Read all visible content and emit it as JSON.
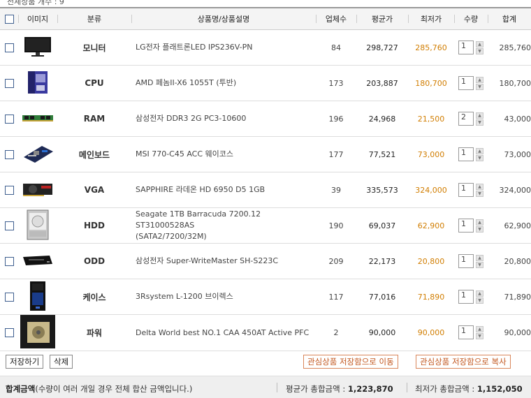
{
  "top_caption": "전체상품 개수 : 9",
  "header": {
    "image": "이미지",
    "category": "분류",
    "name": "상품명/상품설명",
    "sellers": "업체수",
    "avg_price": "평균가",
    "min_price": "최저가",
    "qty": "수량",
    "total": "합계"
  },
  "rows": [
    {
      "category": "모니터",
      "name": "LG전자 플래트론LED IPS236V-PN",
      "sellers": "84",
      "avg": "298,727",
      "min": "285,760",
      "qty": "1",
      "total": "285,760",
      "icon": "monitor-thumbnail"
    },
    {
      "category": "CPU",
      "name": "AMD 페놈II-X6 1055T (투반)",
      "sellers": "173",
      "avg": "203,887",
      "min": "180,700",
      "qty": "1",
      "total": "180,700",
      "icon": "cpu-box-thumbnail"
    },
    {
      "category": "RAM",
      "name": "삼성전자 DDR3 2G PC3-10600",
      "sellers": "196",
      "avg": "24,968",
      "min": "21,500",
      "qty": "2",
      "total": "43,000",
      "icon": "ram-stick-thumbnail"
    },
    {
      "category": "메인보드",
      "name": "MSI 770-C45 ACC 웨이코스",
      "sellers": "177",
      "avg": "77,521",
      "min": "73,000",
      "qty": "1",
      "total": "73,000",
      "icon": "motherboard-thumbnail"
    },
    {
      "category": "VGA",
      "name": "SAPPHIRE 라데온 HD 6950 D5 1GB",
      "sellers": "39",
      "avg": "335,573",
      "min": "324,000",
      "qty": "1",
      "total": "324,000",
      "icon": "graphics-card-thumbnail"
    },
    {
      "category": "HDD",
      "name": "Seagate 1TB Barracuda 7200.12 ST31000528AS",
      "name2": "(SATA2/7200/32M)",
      "sellers": "190",
      "avg": "69,037",
      "min": "62,900",
      "qty": "1",
      "total": "62,900",
      "icon": "hard-drive-thumbnail"
    },
    {
      "category": "ODD",
      "name": "삼성전자 Super-WriteMaster SH-S223C",
      "sellers": "209",
      "avg": "22,173",
      "min": "20,800",
      "qty": "1",
      "total": "20,800",
      "icon": "optical-drive-thumbnail"
    },
    {
      "category": "케이스",
      "name": "3Rsystem L-1200 브이렉스",
      "sellers": "117",
      "avg": "77,016",
      "min": "71,890",
      "qty": "1",
      "total": "71,890",
      "icon": "pc-case-thumbnail"
    },
    {
      "category": "파워",
      "name": "Delta World best NO.1 CAA 450AT Active PFC",
      "sellers": "2",
      "avg": "90,000",
      "min": "90,000",
      "qty": "1",
      "total": "90,000",
      "icon": "power-supply-thumbnail"
    }
  ],
  "buttons": {
    "save": "저장하기",
    "delete": "삭제",
    "move_to_wishlist": "관심상품 저장함으로 이동",
    "copy_to_wishlist": "관심상품 저장함으로 복사"
  },
  "footer": {
    "total_label": "합계금액",
    "total_note": "(수량이 여러 개일 경우 전체 합산 금액입니다.)",
    "avg_total_label": "평균가 총합금액 : ",
    "avg_total_value": "1,223,870",
    "min_total_label": "최저가 총합금액 : ",
    "min_total_value": "1,152,050"
  },
  "colors": {
    "min_price": "#d17d00",
    "button_accent": "#c2571f"
  }
}
